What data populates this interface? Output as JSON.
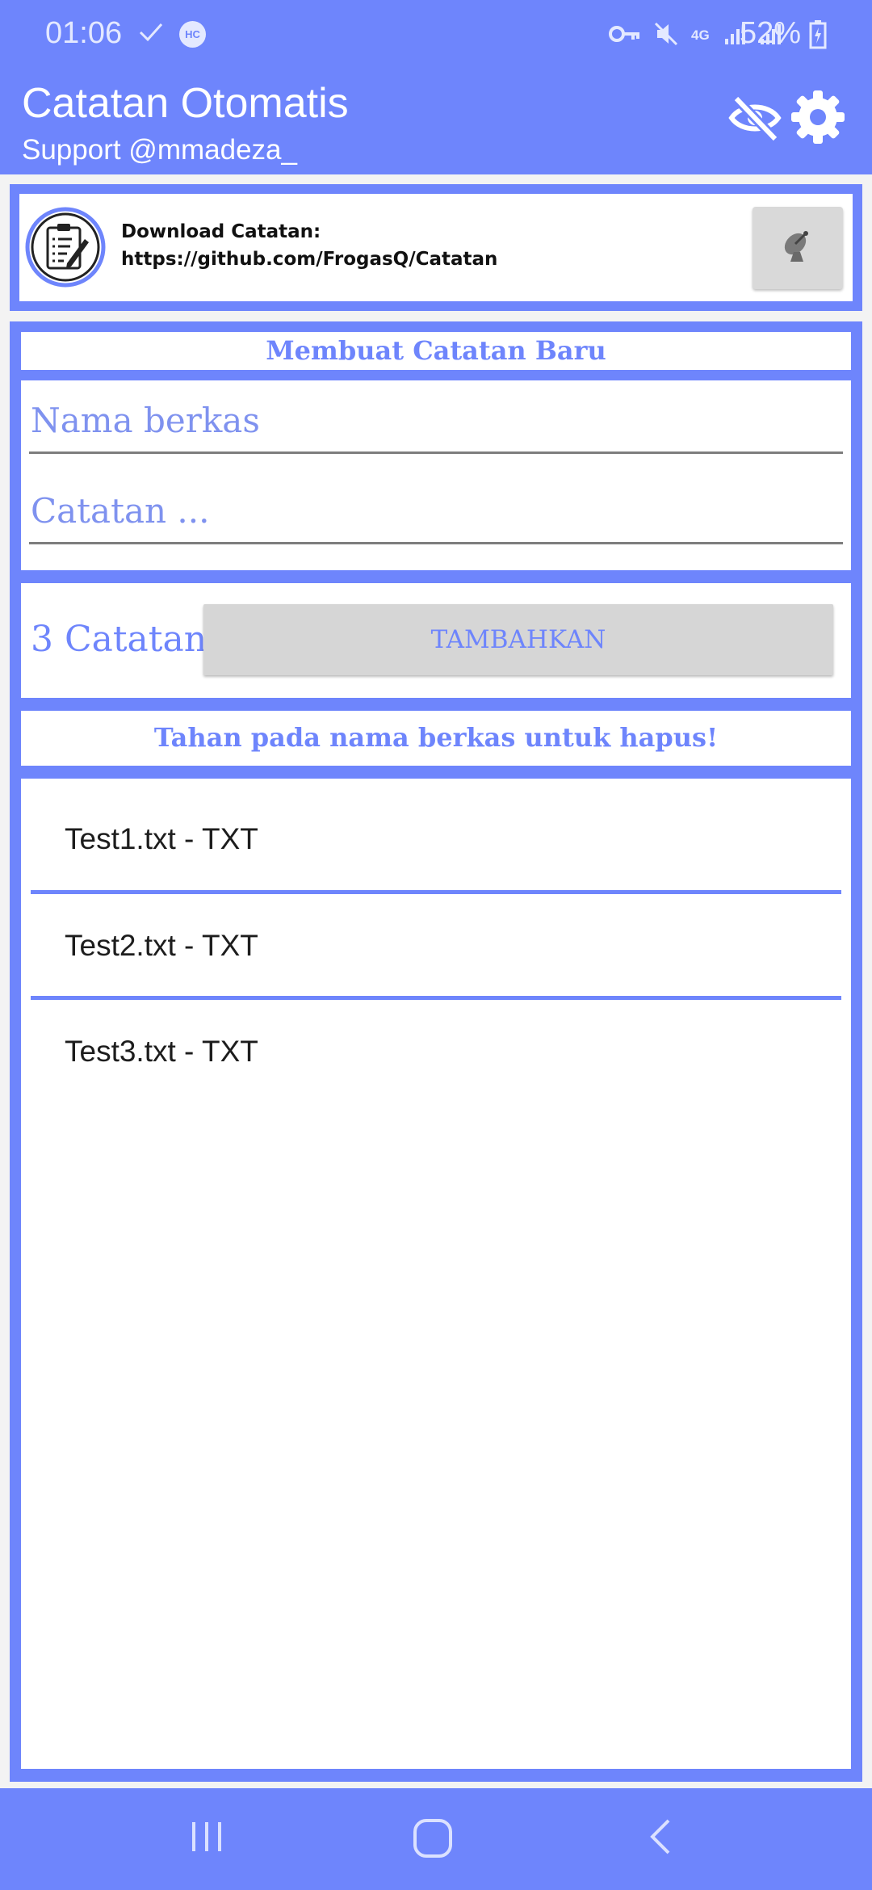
{
  "status_bar": {
    "time": "01:06",
    "hc_badge": "HC",
    "network": "4G",
    "battery": "52%"
  },
  "app_bar": {
    "title": "Catatan Otomatis",
    "subtitle": "Support @mmadeza_"
  },
  "download_card": {
    "line1": "Download Catatan:",
    "line2": "https://github.com/FrogasQ/Catatan"
  },
  "new_note": {
    "title": "Membuat Catatan Baru",
    "filename_placeholder": "Nama berkas",
    "note_placeholder": "Catatan ..."
  },
  "actions": {
    "count_label": "3 Catatan",
    "add_label": "TAMBAHKAN"
  },
  "hint": "Tahan pada nama berkas untuk hapus!",
  "files": [
    {
      "label": "Test1.txt - TXT"
    },
    {
      "label": "Test2.txt - TXT"
    },
    {
      "label": "Test3.txt - TXT"
    }
  ],
  "colors": {
    "accent": "#6e85fc",
    "button_grey": "#d6d6d6"
  },
  "icons": {
    "status_left": [
      "check-icon",
      "hc-icon"
    ],
    "status_right": [
      "vpn-key-icon",
      "mute-icon",
      "signal-icon",
      "signal-icon",
      "battery-charging-icon"
    ],
    "app_bar": [
      "eye-off-icon",
      "gear-icon"
    ],
    "download_card": [
      "note-clipboard-icon",
      "satellite-dish-icon"
    ],
    "nav": [
      "recents-icon",
      "home-icon",
      "back-icon"
    ]
  }
}
